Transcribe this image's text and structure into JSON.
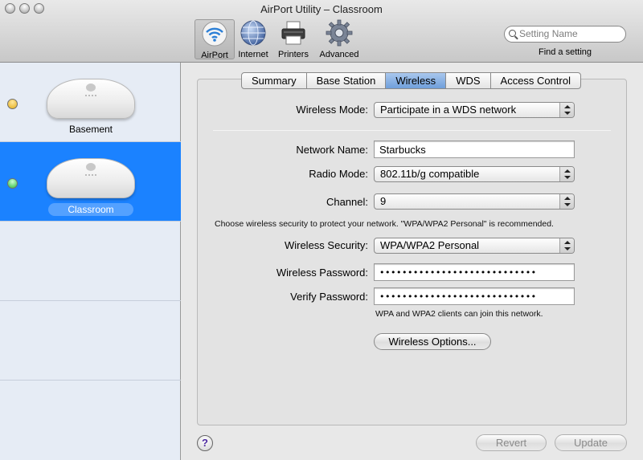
{
  "window": {
    "title": "AirPort Utility – Classroom"
  },
  "toolbar": {
    "items": [
      {
        "label": "AirPort",
        "icon": "airport-wifi-icon",
        "selected": true
      },
      {
        "label": "Internet",
        "icon": "globe-icon",
        "selected": false
      },
      {
        "label": "Printers",
        "icon": "printer-icon",
        "selected": false
      },
      {
        "label": "Advanced",
        "icon": "gear-icon",
        "selected": false
      }
    ],
    "search": {
      "placeholder": "Setting Name",
      "value": ""
    },
    "find_label": "Find a setting"
  },
  "sidebar": {
    "devices": [
      {
        "name": "Basement",
        "status_color": "#f0c030",
        "selected": false
      },
      {
        "name": "Classroom",
        "status_color": "#4fd85c",
        "selected": true
      }
    ]
  },
  "tabs": [
    {
      "label": "Summary",
      "active": false
    },
    {
      "label": "Base Station",
      "active": false
    },
    {
      "label": "Wireless",
      "active": true
    },
    {
      "label": "WDS",
      "active": false
    },
    {
      "label": "Access Control",
      "active": false
    }
  ],
  "form": {
    "wireless_mode": {
      "label": "Wireless Mode:",
      "value": "Participate in a WDS network"
    },
    "network_name": {
      "label": "Network Name:",
      "value": "Starbucks"
    },
    "radio_mode": {
      "label": "Radio Mode:",
      "value": "802.11b/g compatible"
    },
    "channel": {
      "label": "Channel:",
      "value": "9"
    },
    "security_note": "Choose wireless security to protect your network. \"WPA/WPA2 Personal\" is recommended.",
    "wireless_security": {
      "label": "Wireless Security:",
      "value": "WPA/WPA2 Personal"
    },
    "wireless_password": {
      "label": "Wireless Password:",
      "value": "••••••••••••••••••••••••••••"
    },
    "verify_password": {
      "label": "Verify Password:",
      "value": "••••••••••••••••••••••••••••"
    },
    "clients_note": "WPA and WPA2 clients can join this network.",
    "options_button": "Wireless Options..."
  },
  "footer": {
    "help_label": "?",
    "revert_label": "Revert",
    "update_label": "Update"
  }
}
